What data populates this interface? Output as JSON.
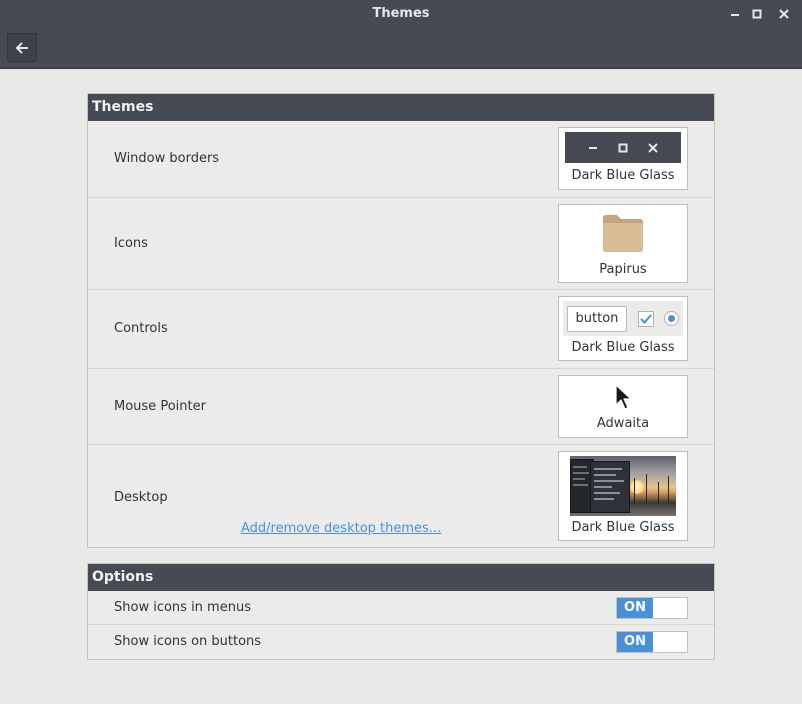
{
  "window": {
    "title": "Themes"
  },
  "themes": {
    "header": "Themes",
    "window_borders": {
      "label": "Window borders",
      "value": "Dark Blue Glass"
    },
    "icons": {
      "label": "Icons",
      "value": "Papirus"
    },
    "controls": {
      "label": "Controls",
      "value": "Dark Blue Glass",
      "preview_button": "button",
      "preview_checkbox_checked": true,
      "preview_radio_selected": true
    },
    "mouse_pointer": {
      "label": "Mouse Pointer",
      "value": "Adwaita"
    },
    "desktop": {
      "label": "Desktop",
      "value": "Dark Blue Glass",
      "link": "Add/remove desktop themes..."
    }
  },
  "options": {
    "header": "Options",
    "items": [
      {
        "label": "Show icons in menus",
        "state": "ON"
      },
      {
        "label": "Show icons on buttons",
        "state": "ON"
      }
    ]
  },
  "colors": {
    "accent": "#4a90d9",
    "header_bg": "#464a53",
    "window_bg": "#e8e8e7",
    "folder": "#d2b48c"
  }
}
